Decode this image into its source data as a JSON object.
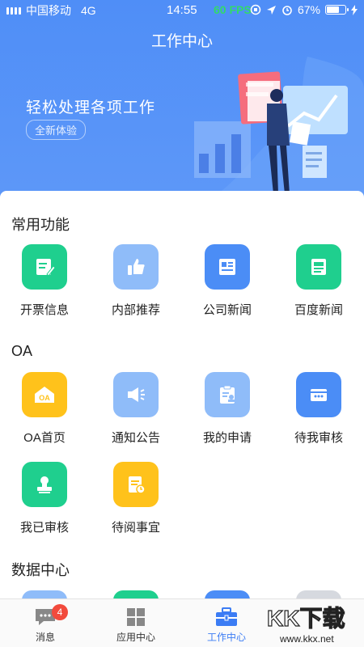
{
  "status_bar": {
    "carrier": "中国移动",
    "network": "4G",
    "time": "14:55",
    "fps": "60 FPS",
    "battery": "67%",
    "battery_level": 0.67
  },
  "header": {
    "title": "工作中心",
    "banner_text": "轻松处理各项工作",
    "banner_pill": "全新体验"
  },
  "sections": {
    "common": {
      "title": "常用功能",
      "items": [
        {
          "label": "开票信息",
          "icon": "invoice-icon",
          "color": "#1fcf8e"
        },
        {
          "label": "内部推荐",
          "icon": "thumbs-up-icon",
          "color": "#8fbcf9"
        },
        {
          "label": "公司新闻",
          "icon": "news-icon",
          "color": "#4b8df6"
        },
        {
          "label": "百度新闻",
          "icon": "newspaper-icon",
          "color": "#1fcf8e"
        }
      ]
    },
    "oa": {
      "title": "OA",
      "items": [
        {
          "label": "OA首页",
          "icon": "oa-home-icon",
          "color": "#ffc21b",
          "icon_text": "OA"
        },
        {
          "label": "通知公告",
          "icon": "megaphone-icon",
          "color": "#8fbcf9"
        },
        {
          "label": "我的申请",
          "icon": "clipboard-user-icon",
          "color": "#8fbcf9"
        },
        {
          "label": "待我审核",
          "icon": "card-icon",
          "color": "#4b8df6"
        },
        {
          "label": "我已审核",
          "icon": "stamp-icon",
          "color": "#1fcf8e"
        },
        {
          "label": "待阅事宜",
          "icon": "document-clock-icon",
          "color": "#ffc21b"
        }
      ]
    },
    "data": {
      "title": "数据中心"
    }
  },
  "tabbar": {
    "tabs": [
      {
        "label": "消息",
        "icon": "message-icon",
        "badge": "4"
      },
      {
        "label": "应用中心",
        "icon": "grid-icon"
      },
      {
        "label": "工作中心",
        "icon": "briefcase-icon",
        "active": true
      }
    ]
  },
  "watermark": {
    "text": "KK下载",
    "url": "www.kkx.net"
  }
}
